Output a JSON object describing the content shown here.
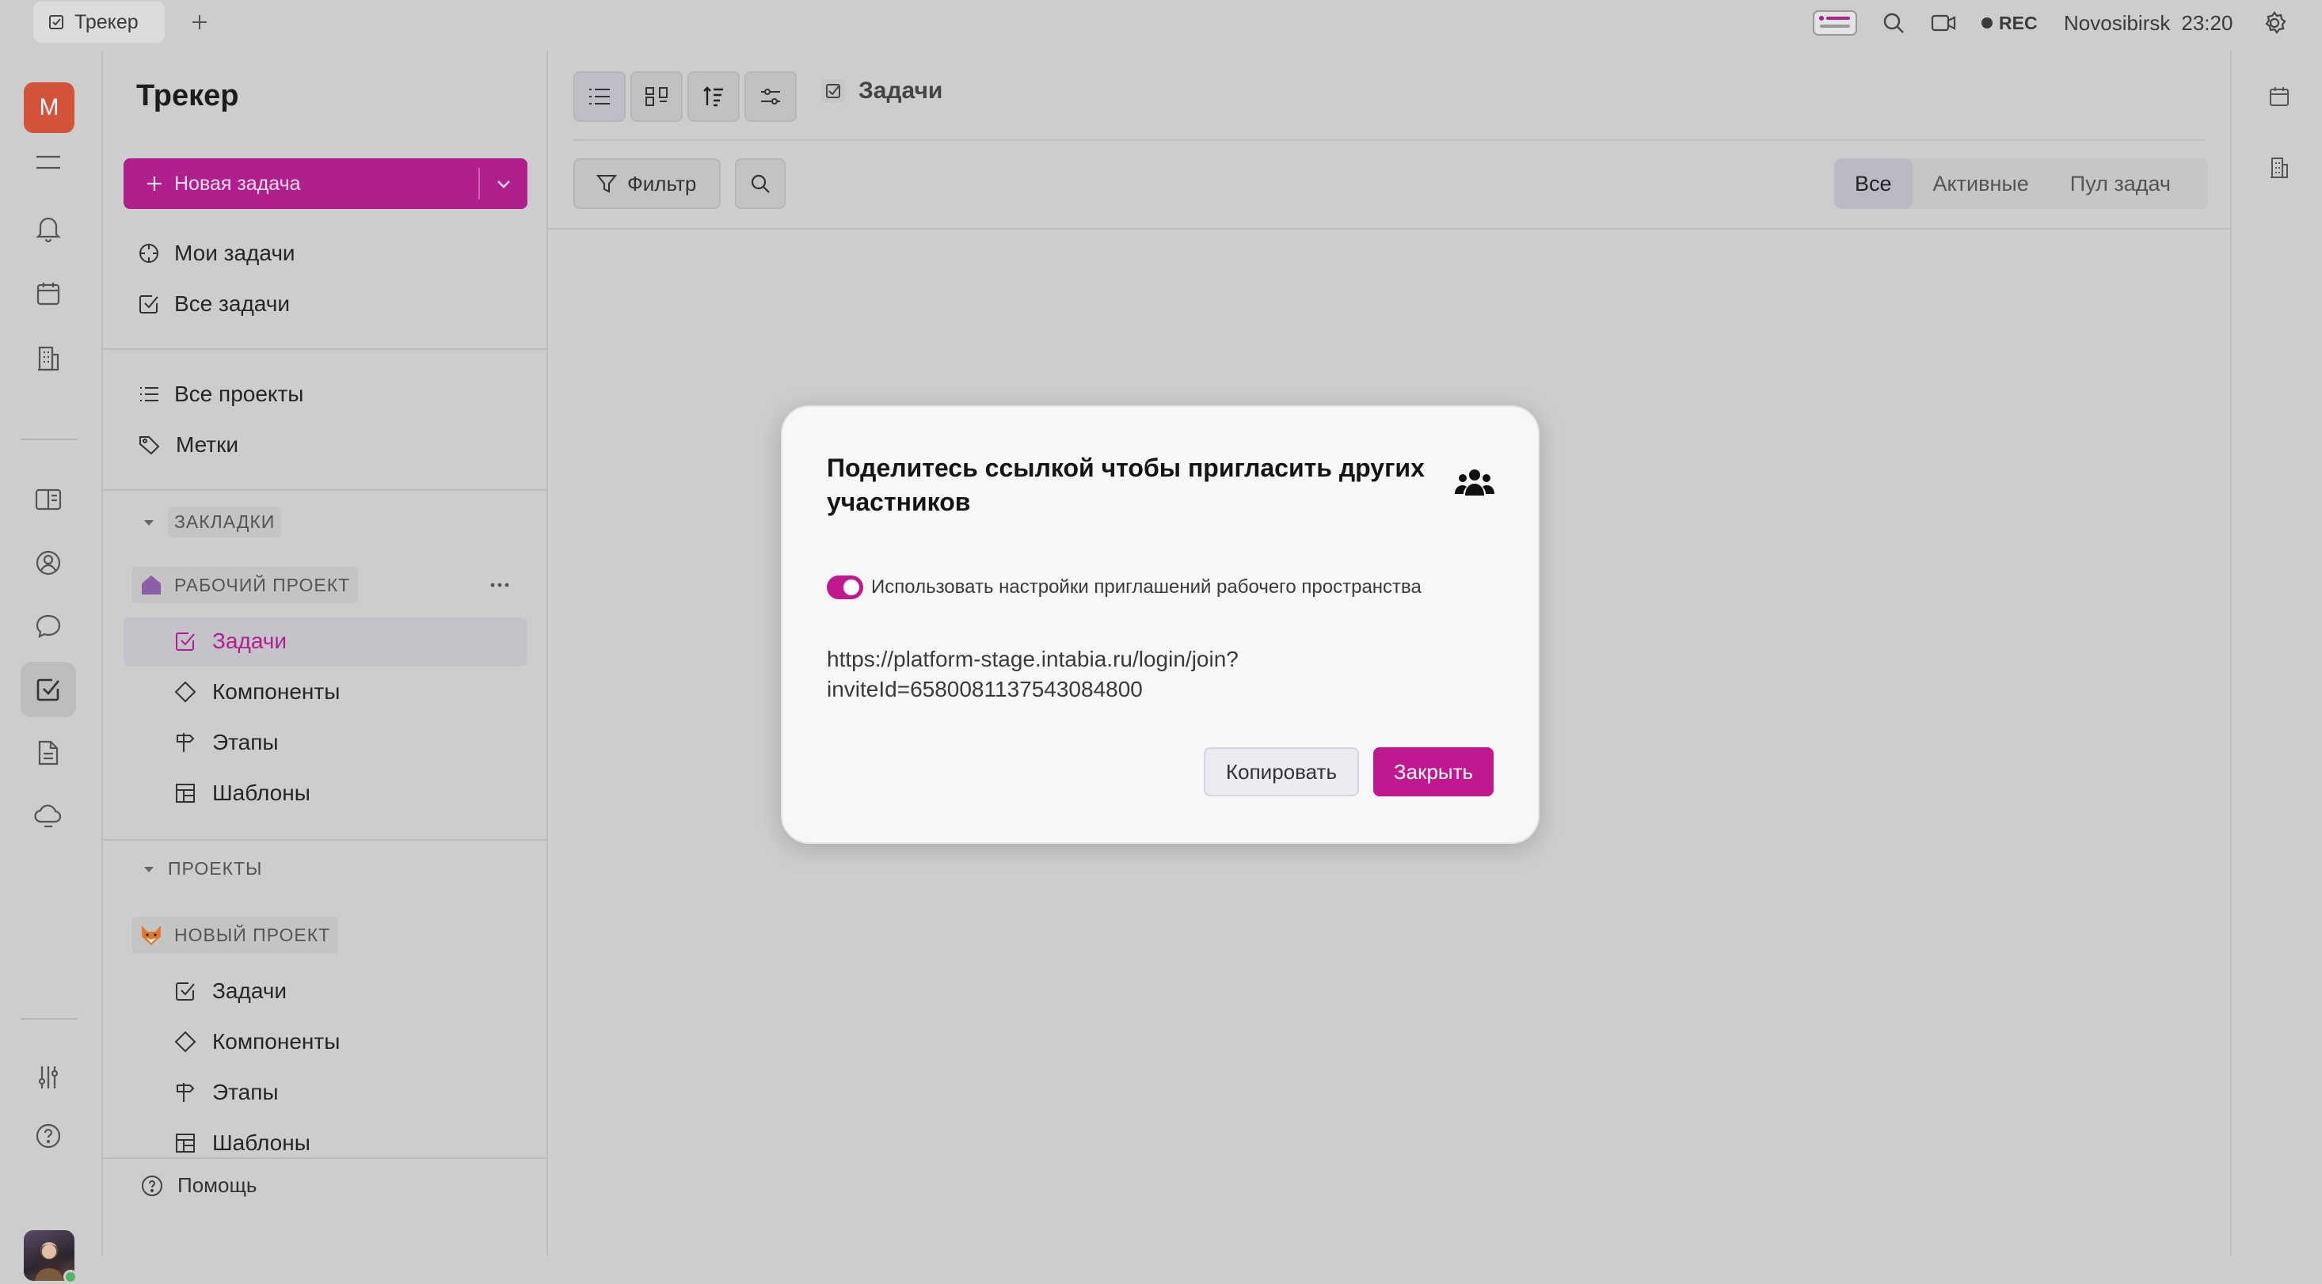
{
  "topbar": {
    "tab_label": "Трекер",
    "rec_label": "REC",
    "location": "Novosibirsk",
    "time": "23:20"
  },
  "rail": {
    "avatar_letter": "M"
  },
  "nav": {
    "title": "Трекер",
    "new_task": "Новая задача",
    "my_tasks": "Мои задачи",
    "all_tasks": "Все задачи",
    "all_projects": "Все проекты",
    "labels": "Метки",
    "bookmarks_header": "ЗАКЛАДКИ",
    "workspace_project": "РАБОЧИЙ ПРОЕКТ",
    "projects_header": "ПРОЕКТЫ",
    "new_project": "НОВЫЙ ПРОЕКТ",
    "sub_items": [
      "Задачи",
      "Компоненты",
      "Этапы",
      "Шаблоны"
    ],
    "help": "Помощь"
  },
  "main": {
    "breadcrumb": "Задачи",
    "filter": "Фильтр",
    "segments": [
      "Все",
      "Активные",
      "Пул задач"
    ]
  },
  "modal": {
    "title": "Поделитесь ссылкой чтобы пригласить других участников",
    "toggle_label": "Использовать настройки приглашений рабочего пространства",
    "toggle_on": true,
    "link_line1": "https://platform-stage.intabia.ru/login/join?",
    "link_line2": "inviteId=6580081137543084800",
    "copy_button": "Копировать",
    "close_button": "Закрыть"
  },
  "colors": {
    "accent": "#b0208d",
    "background": "#cdcdcd",
    "modal_bg": "#f7f7f7"
  }
}
